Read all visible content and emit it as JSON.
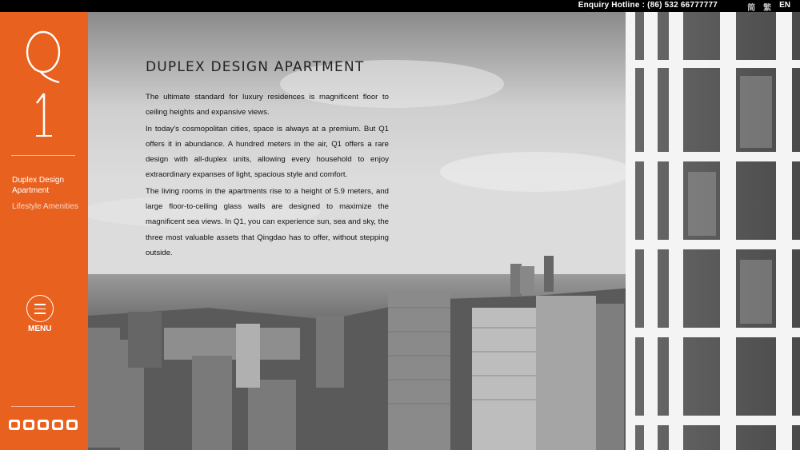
{
  "topbar": {
    "hotline": "Enquiry Hotline : (86) 532 66777777",
    "languages": [
      {
        "label": "简",
        "active": false
      },
      {
        "label": "繁",
        "active": false
      },
      {
        "label": "EN",
        "active": true
      }
    ]
  },
  "sidebar": {
    "logo_text": "Q1",
    "nav": [
      {
        "label": "Duplex Design Apartment",
        "active": true
      },
      {
        "label": "Lifestyle Amenities",
        "active": false
      }
    ],
    "menu_label": "MENU",
    "social_icons": [
      "weibo-icon",
      "image-icon",
      "renren-icon",
      "douban-icon",
      "wechat-icon"
    ],
    "accent_color": "#e8611f"
  },
  "content": {
    "title": "DUPLEX DESIGN APARTMENT",
    "paragraphs": [
      "The ultimate standard for luxury residences is magnificent floor to ceiling heights and expansive views.",
      "In today's cosmopolitan cities, space is always at a premium. But Q1 offers it in abundance. A hundred meters in the air, Q1 offers a rare design with all-duplex units, allowing every household to enjoy extraordinary expanses of light, spacious style and comfort.",
      "The living rooms in the apartments rise to a height of 5.9 meters, and large floor-to-ceiling glass walls are designed to maximize the magnificent sea views. In Q1, you can experience sun, sea and sky, the three most valuable assets that Qingdao has to offer, without stepping outside."
    ]
  }
}
